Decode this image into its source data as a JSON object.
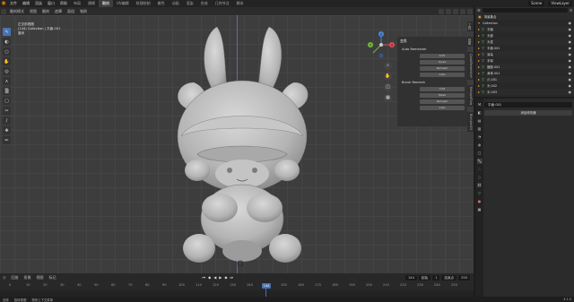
{
  "topbar": {
    "menus": [
      "文件",
      "编辑",
      "渲染",
      "窗口",
      "帮助"
    ],
    "tabs": [
      "布局",
      "建模",
      "雕刻",
      "UV编辑",
      "纹理绘制",
      "着色",
      "动画",
      "渲染",
      "合成",
      "几何节点",
      "脚本"
    ],
    "active_tab": "雕刻",
    "scene": "Scene",
    "view_layer": "ViewLayer"
  },
  "viewport_header": {
    "mode": "雕刻模式",
    "menus": [
      "视图",
      "雕刻",
      "遮罩",
      "面组",
      "笔刷"
    ],
    "info_lines": [
      "正交前视图",
      "(144) Collection | 平面.001",
      "厘米"
    ]
  },
  "navigation": {
    "gizmo_axes": [
      "Y",
      "X",
      "Z"
    ],
    "colors": {
      "x": "#e34a55",
      "y": "#74b636",
      "z": "#4f86d6"
    }
  },
  "npanel": {
    "header": "变换",
    "sections": [
      {
        "title": "Auto Remesher",
        "rows": [
          [
            "",
            "0.05"
          ],
          [
            "",
            "Quad"
          ],
          [
            "",
            "Remesh"
          ],
          [
            "",
            "Auto"
          ]
        ]
      },
      {
        "title": "Brush Remesh",
        "rows": [
          [
            "",
            "0.05"
          ],
          [
            "",
            "Mesh"
          ],
          [
            "",
            "Remesh"
          ],
          [
            "",
            "Auto"
          ]
        ]
      }
    ],
    "tabs": [
      "工具",
      "视图",
      "QuadRemesher",
      "RetopoFlow",
      "BlenderKit"
    ]
  },
  "timeline": {
    "menus": [
      "回放",
      "抠像",
      "视图",
      "标记"
    ],
    "ticks": [
      "0",
      "10",
      "20",
      "30",
      "40",
      "50",
      "60",
      "70",
      "80",
      "90",
      "100",
      "110",
      "120",
      "130",
      "140",
      "150",
      "160",
      "170",
      "180",
      "190",
      "200",
      "210",
      "220",
      "230",
      "240",
      "250"
    ],
    "current_frame": "144",
    "frame_current_field": "144",
    "start_label": "起始",
    "start": "1",
    "end_label": "结束点",
    "end": "250"
  },
  "statusbar": {
    "items": [
      "选择",
      "旋转视图",
      "物体上下文菜单"
    ],
    "version": "4.1.0"
  },
  "outliner": {
    "search_placeholder": "",
    "rows": [
      {
        "name": "场景集合",
        "tri": ""
      },
      {
        "name": "Collection",
        "tri": "▾"
      },
      {
        "name": "平面",
        "tri": "▸"
      },
      {
        "name": "头部",
        "tri": "▸"
      },
      {
        "name": "头发",
        "tri": "▸"
      },
      {
        "name": "平面.001",
        "tri": "▸"
      },
      {
        "name": "耳朵",
        "tri": "▸"
      },
      {
        "name": "手臂",
        "tri": "▸"
      },
      {
        "name": "腿部.001",
        "tri": "▸"
      },
      {
        "name": "身体.001",
        "tri": "▸"
      },
      {
        "name": "爪.001",
        "tri": "▸"
      },
      {
        "name": "头.002",
        "tri": "▸"
      },
      {
        "name": "头.003",
        "tri": "▸"
      }
    ]
  },
  "properties": {
    "object_name": "平面.001",
    "add_modifier": "添加修改器"
  }
}
